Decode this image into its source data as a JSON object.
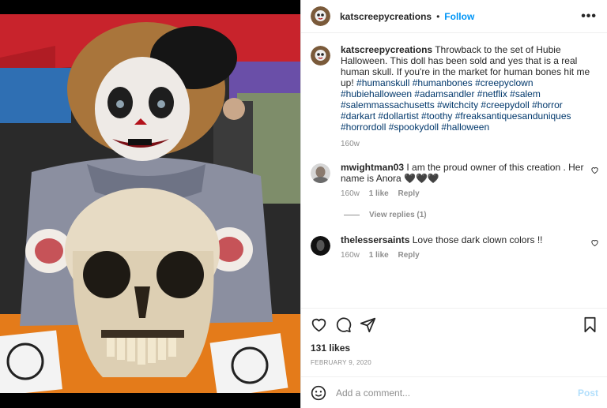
{
  "post": {
    "username": "katscreepycreations",
    "follow_label": "Follow",
    "header_separator": "•",
    "more_label": "•••",
    "caption_text": "Throwback to the set of Hubie Halloween. This doll has been sold and yes that is a real human skull. If you're in the market for human bones hit me up!",
    "hashtags": "#humanskull #humanbones #creepyclown #hubiehalloween #adamsandler #netflix #salem #salemmassachusetts #witchcity #creepydoll #horror #darkart #dollartist #toothy #freaksantiquesanduniques #horrordoll #spookydoll #halloween",
    "caption_time": "160w",
    "likes": "131 likes",
    "date": "FEBRUARY 9, 2020",
    "comment_placeholder": "Add a comment...",
    "post_label": "Post"
  },
  "comments": [
    {
      "username": "mwightman03",
      "text": "I am the proud owner of this creation . Her name is Anora 🖤🖤🖤",
      "time": "160w",
      "likes": "1 like",
      "reply_label": "Reply",
      "view_replies": "View replies (1)"
    },
    {
      "username": "thelessersaints",
      "text": "Love those dark clown colors !!",
      "time": "160w",
      "likes": "1 like",
      "reply_label": "Reply"
    }
  ],
  "colors": {
    "follow_blue": "#0095f6",
    "hashtag_blue": "#00376b",
    "muted_gray": "#8e8e8e",
    "post_disabled": "#b2dffc"
  },
  "icons": [
    "heart-icon",
    "comment-icon",
    "share-icon",
    "bookmark-icon",
    "emoji-icon",
    "more-icon"
  ]
}
